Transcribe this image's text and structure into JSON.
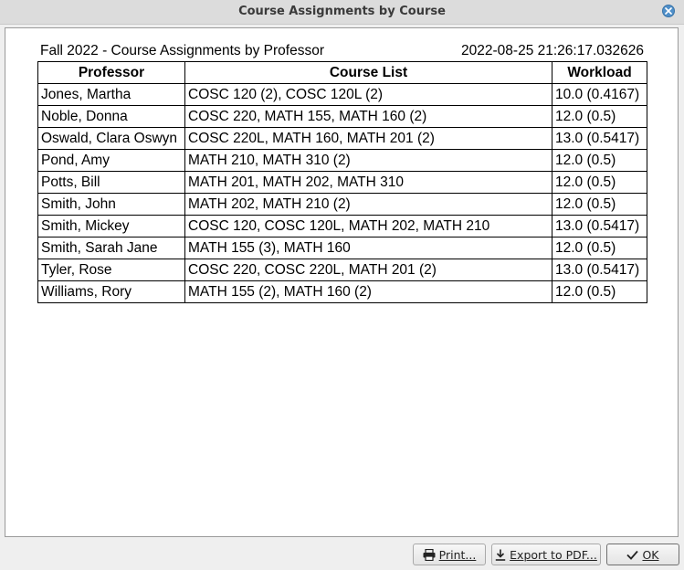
{
  "window": {
    "title": "Course Assignments by Course"
  },
  "report": {
    "title": "Fall 2022 - Course Assignments by Professor",
    "timestamp": "2022-08-25 21:26:17.032626",
    "columns": [
      "Professor",
      "Course List",
      "Workload"
    ],
    "rows": [
      {
        "professor": "Jones, Martha",
        "courses": "COSC 120 (2), COSC 120L (2)",
        "workload": "10.0 (0.4167)"
      },
      {
        "professor": "Noble, Donna",
        "courses": "COSC 220, MATH 155, MATH 160 (2)",
        "workload": "12.0 (0.5)"
      },
      {
        "professor": "Oswald, Clara Oswyn",
        "courses": "COSC 220L, MATH 160, MATH 201 (2)",
        "workload": "13.0 (0.5417)"
      },
      {
        "professor": "Pond, Amy",
        "courses": "MATH 210, MATH 310 (2)",
        "workload": "12.0 (0.5)"
      },
      {
        "professor": "Potts, Bill",
        "courses": "MATH 201, MATH 202, MATH 310",
        "workload": "12.0 (0.5)"
      },
      {
        "professor": "Smith, John",
        "courses": "MATH 202, MATH 210 (2)",
        "workload": "12.0 (0.5)"
      },
      {
        "professor": "Smith, Mickey",
        "courses": "COSC 120, COSC 120L, MATH 202, MATH 210",
        "workload": "13.0 (0.5417)"
      },
      {
        "professor": "Smith, Sarah Jane",
        "courses": "MATH 155 (3), MATH 160",
        "workload": "12.0 (0.5)"
      },
      {
        "professor": "Tyler, Rose",
        "courses": "COSC 220, COSC 220L, MATH 201 (2)",
        "workload": "13.0 (0.5417)"
      },
      {
        "professor": "Williams, Rory",
        "courses": "MATH 155 (2), MATH 160 (2)",
        "workload": "12.0 (0.5)"
      }
    ]
  },
  "buttons": {
    "print": {
      "label": "Print...",
      "icon": "printer-icon"
    },
    "export": {
      "label": "Export to PDF...",
      "icon": "download-icon"
    },
    "ok": {
      "label": "OK",
      "icon": "checkmark-icon"
    }
  },
  "colors": {
    "close_button": "#4f8fc9",
    "titlebar": "#dcdcdc",
    "content_bg": "#ffffff"
  }
}
